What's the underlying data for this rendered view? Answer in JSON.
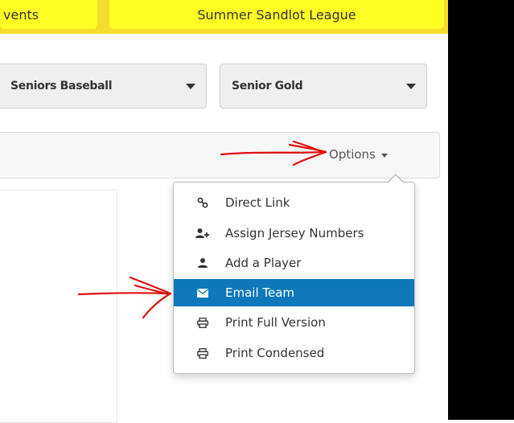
{
  "tabs": [
    {
      "label": "vents"
    },
    {
      "label": "Summer Sandlot League"
    }
  ],
  "filters": {
    "division": "Seniors Baseball",
    "team": "Senior Gold"
  },
  "toolbar": {
    "options_label": "Options"
  },
  "menu": {
    "items": [
      {
        "label": "Direct Link",
        "icon": "link-icon"
      },
      {
        "label": "Assign Jersey Numbers",
        "icon": "user-plus-icon"
      },
      {
        "label": "Add a Player",
        "icon": "user-icon"
      },
      {
        "label": "Email Team",
        "icon": "envelope-icon",
        "active": true
      },
      {
        "label": "Print Full Version",
        "icon": "print-icon"
      },
      {
        "label": "Print Condensed",
        "icon": "print-icon"
      }
    ]
  },
  "colors": {
    "tab_yellow": "#ffff24",
    "strip_yellow": "#f5dd2e",
    "active_blue": "#0e78ba",
    "annotation_red": "#e01010"
  }
}
